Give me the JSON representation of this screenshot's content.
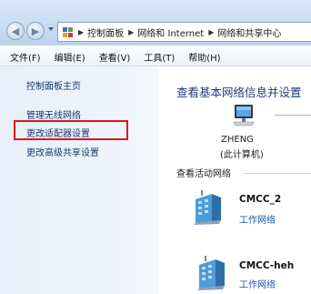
{
  "address_bar": {
    "crumbs": [
      "控制面板",
      "网络和 Internet",
      "网络和共享中心"
    ]
  },
  "menu": [
    "文件(F)",
    "编辑(E)",
    "查看(V)",
    "工具(T)",
    "帮助(H)"
  ],
  "sidebar": {
    "items": [
      "控制面板主页",
      "管理无线网络",
      "更改适配器设置",
      "更改高级共享设置"
    ],
    "highlighted_item": "更改适配器设置",
    "highlight_color": "#e0151b"
  },
  "main": {
    "title": "查看基本网络信息并设置",
    "computer": {
      "name": "ZHENG",
      "subtitle": "(此计算机)"
    },
    "active_section_title": "查看活动网络",
    "networks": [
      {
        "name": "CMCC_2",
        "type": "工作网络"
      },
      {
        "name": "CMCC-heh",
        "type": "工作网络"
      }
    ]
  },
  "icons": [
    "back-arrow-icon",
    "forward-arrow-icon",
    "control-panel-icon",
    "computer-icon",
    "network-building-icon"
  ]
}
